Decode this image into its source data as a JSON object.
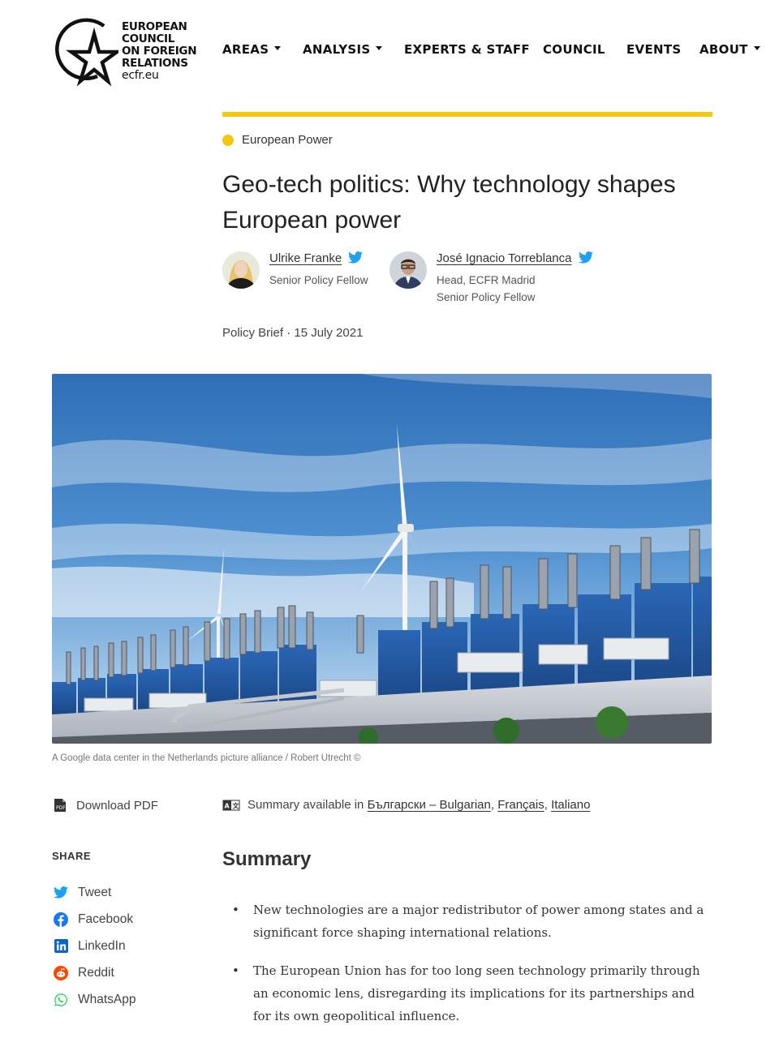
{
  "logo": {
    "lines": [
      "EUROPEAN",
      "COUNCIL",
      "ON FOREIGN",
      "RELATIONS"
    ],
    "url": "ecfr.eu"
  },
  "nav": {
    "items": [
      {
        "label": "AREAS",
        "has_caret": true
      },
      {
        "label": "ANALYSIS",
        "has_caret": true
      },
      {
        "label": "EXPERTS & STAFF",
        "has_caret": false
      },
      {
        "label": "COUNCIL",
        "has_caret": false
      },
      {
        "label": "EVENTS",
        "has_caret": false
      },
      {
        "label": "ABOUT",
        "has_caret": true
      }
    ]
  },
  "article": {
    "category": "European Power",
    "title": "Geo-tech politics: Why technology shapes European power",
    "authors": [
      {
        "name": "Ulrike Franke",
        "role_line1": "Senior Policy Fellow",
        "role_line2": ""
      },
      {
        "name": "José Ignacio Torreblanca",
        "role_line1": "Head, ECFR Madrid",
        "role_line2": "Senior Policy Fellow"
      }
    ],
    "meta": "Policy Brief · 15 July 2021",
    "image_caption": "A Google data center in the Netherlands   picture alliance / Robert Utrecht ©",
    "download_label": "Download PDF",
    "summary_prefix": "Summary available in",
    "summary_languages": [
      "Български – Bulgarian",
      "Français",
      "Italiano"
    ],
    "summary_heading": "Summary",
    "bullets": [
      "New technologies are a major redistributor of power among states and a significant force shaping international relations.",
      "The European Union has for too long seen technology primarily through an economic lens, disregarding its implications for its partnerships and for its own geopolitical influence."
    ]
  },
  "share": {
    "title": "SHARE",
    "items": [
      {
        "label": "Tweet",
        "icon": "twitter-icon"
      },
      {
        "label": "Facebook",
        "icon": "facebook-icon"
      },
      {
        "label": "LinkedIn",
        "icon": "linkedin-icon"
      },
      {
        "label": "Reddit",
        "icon": "reddit-icon"
      },
      {
        "label": "WhatsApp",
        "icon": "whatsapp-icon"
      }
    ]
  },
  "colors": {
    "accent_yellow": "#f2c811",
    "twitter_blue": "#1da1f2"
  }
}
